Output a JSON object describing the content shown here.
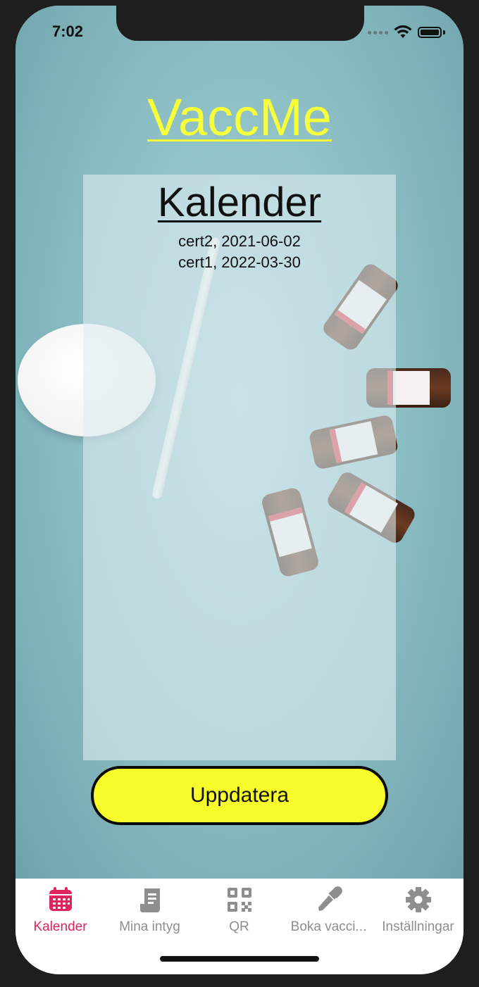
{
  "status_bar": {
    "time": "7:02"
  },
  "app": {
    "title": "VaccMe"
  },
  "calendar": {
    "title": "Kalender",
    "entries": [
      "cert2, 2021-06-02",
      "cert1, 2022-03-30"
    ]
  },
  "actions": {
    "update_label": "Uppdatera"
  },
  "tab_bar": {
    "active_color": "#e0245e",
    "inactive_color": "#8e8e8e",
    "items": [
      {
        "label": "Kalender",
        "icon": "calendar-icon",
        "active": true
      },
      {
        "label": "Mina intyg",
        "icon": "receipt-icon",
        "active": false
      },
      {
        "label": "QR",
        "icon": "qr-code-icon",
        "active": false
      },
      {
        "label": "Boka vacci...",
        "icon": "dropper-icon",
        "active": false
      },
      {
        "label": "Inställningar",
        "icon": "gear-icon",
        "active": false
      }
    ]
  },
  "colors": {
    "title_yellow": "#f5ff3a",
    "button_yellow": "#f8fb2a",
    "background_teal": "#8ec0c6"
  }
}
